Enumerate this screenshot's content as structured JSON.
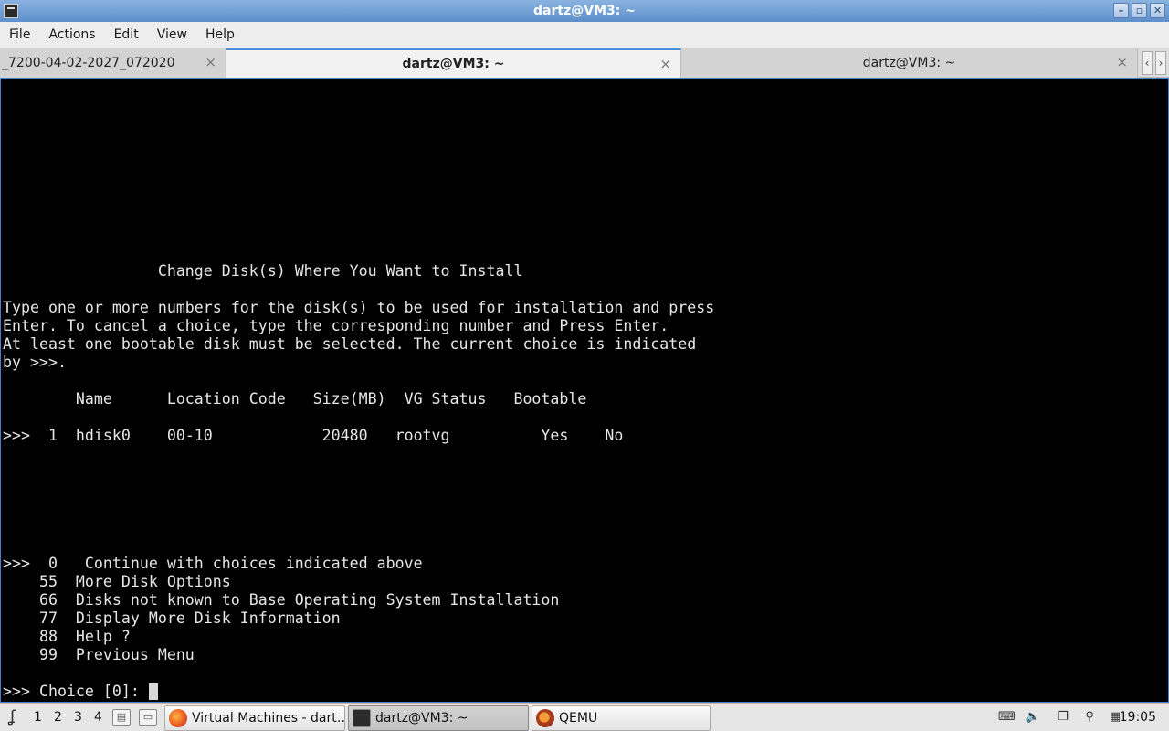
{
  "window": {
    "title": "dartz@VM3: ~",
    "icon": "terminal-icon",
    "minimize": "–",
    "maximize": "▫",
    "close": "✕"
  },
  "menu": [
    "File",
    "Actions",
    "Edit",
    "View",
    "Help"
  ],
  "tabs": [
    {
      "label": "_7200-04-02-2027_072020",
      "active": false
    },
    {
      "label": "dartz@VM3: ~",
      "active": true
    },
    {
      "label": "dartz@VM3: ~",
      "active": false
    }
  ],
  "tab_scroll": {
    "left": "‹",
    "right": "›"
  },
  "terminal": {
    "heading": "                 Change Disk(s) Where You Want to Install",
    "instructions": [
      "Type one or more numbers for the disk(s) to be used for installation and press",
      "Enter. To cancel a choice, type the corresponding number and Press Enter.",
      "At least one bootable disk must be selected. The current choice is indicated",
      "by >>>."
    ],
    "table_header": "        Name      Location Code   Size(MB)  VG Status   Bootable",
    "disk_row": ">>>  1  hdisk0    00-10            20480   rootvg          Yes    No",
    "options": [
      ">>>  0   Continue with choices indicated above",
      "    55  More Disk Options",
      "    66  Disks not known to Base Operating System Installation",
      "    77  Display More Disk Information",
      "    88  Help ?",
      "    99  Previous Menu"
    ],
    "prompt": ">>> Choice [0]: "
  },
  "taskbar": {
    "start_icon": "start-menu-icon",
    "desktops": [
      "1",
      "2",
      "3",
      "4"
    ],
    "tasks": [
      {
        "label": "Virtual Machines - dart…",
        "icon": "firefox-icon",
        "active": false
      },
      {
        "label": "dartz@VM3: ~",
        "icon": "terminal-icon",
        "active": true
      },
      {
        "label": "QEMU",
        "icon": "qemu-icon",
        "active": false
      }
    ],
    "clock": "19:05"
  }
}
